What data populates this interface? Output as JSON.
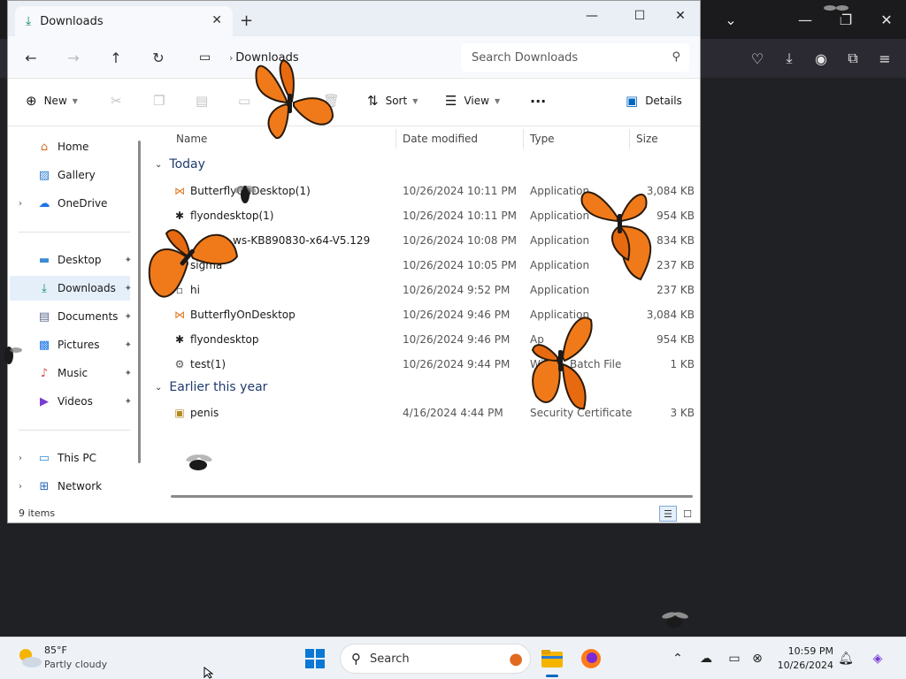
{
  "explorer": {
    "tab_title": "Downloads",
    "address_location": "Downloads",
    "search_placeholder": "Search Downloads",
    "commands": {
      "new": "New",
      "sort": "Sort",
      "view": "View",
      "more": "...",
      "details": "Details"
    },
    "columns": {
      "name": "Name",
      "date_modified": "Date modified",
      "type": "Type",
      "size": "Size"
    },
    "sidebar": {
      "home": "Home",
      "gallery": "Gallery",
      "onedrive": "OneDrive",
      "desktop": "Desktop",
      "downloads": "Downloads",
      "documents": "Documents",
      "pictures": "Pictures",
      "music": "Music",
      "videos": "Videos",
      "this_pc": "This PC",
      "network": "Network"
    },
    "groups": {
      "today": "Today",
      "earlier": "Earlier this year"
    },
    "files": [
      {
        "name": "ButterflyOnDesktop(1)",
        "date": "10/26/2024 10:11 PM",
        "type": "Application",
        "size": "3,084 KB"
      },
      {
        "name": "flyondesktop(1)",
        "date": "10/26/2024 10:11 PM",
        "type": "Application",
        "size": "954 KB"
      },
      {
        "name": "ws-KB890830-x64-V5.129",
        "date": "10/26/2024 10:08 PM",
        "type": "Application",
        "size": "834 KB"
      },
      {
        "name": "sigma",
        "date": "10/26/2024 10:05 PM",
        "type": "Application",
        "size": "237 KB"
      },
      {
        "name": "hi",
        "date": "10/26/2024 9:52 PM",
        "type": "Application",
        "size": "237 KB"
      },
      {
        "name": "ButterflyOnDesktop",
        "date": "10/26/2024 9:46 PM",
        "type": "Application",
        "size": "3,084 KB"
      },
      {
        "name": "flyondesktop",
        "date": "10/26/2024 9:46 PM",
        "type": "Ap",
        "size": "954 KB"
      },
      {
        "name": "test(1)",
        "date": "10/26/2024 9:44 PM",
        "type": "Win",
        "type_tail": "Batch File",
        "size": "1 KB"
      },
      {
        "name": "penis",
        "date": "4/16/2024 4:44 PM",
        "type": "Security Certificate",
        "size": "3 KB"
      }
    ],
    "status": "9 items"
  },
  "taskbar": {
    "weather_temp": "85°F",
    "weather_desc": "Partly cloudy",
    "search_label": "Search",
    "clock_time": "10:59 PM",
    "clock_date": "10/26/2024"
  },
  "colors": {
    "accent": "#0067c0",
    "folder": "#f4b400",
    "butterfly": "#f07a1a"
  }
}
